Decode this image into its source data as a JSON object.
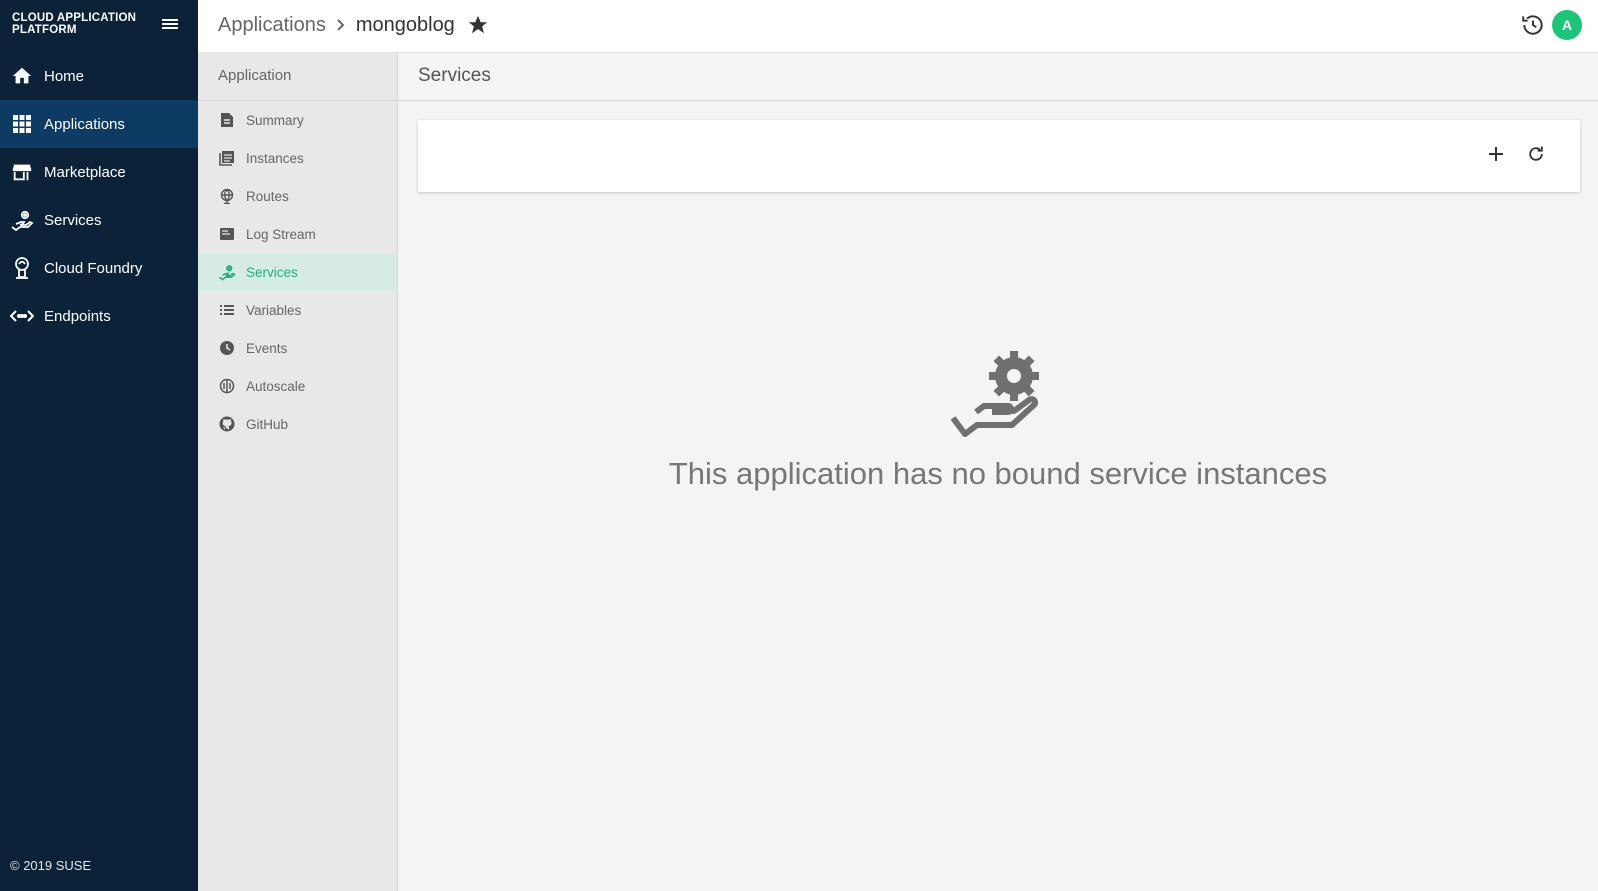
{
  "brand": {
    "line1": "CLOUD APPLICATION",
    "line2": "PLATFORM"
  },
  "sidebar": {
    "items": [
      {
        "label": "Home",
        "icon": "home-icon"
      },
      {
        "label": "Applications",
        "icon": "apps-grid-icon",
        "active": true
      },
      {
        "label": "Marketplace",
        "icon": "store-icon"
      },
      {
        "label": "Services",
        "icon": "service-hand-icon"
      },
      {
        "label": "Cloud Foundry",
        "icon": "cloud-foundry-icon"
      },
      {
        "label": "Endpoints",
        "icon": "endpoints-icon"
      }
    ],
    "copyright": "© 2019 SUSE"
  },
  "header": {
    "breadcrumb_parent": "Applications",
    "breadcrumb_current": "mongoblog",
    "avatar_initial": "A"
  },
  "subnav": {
    "title": "Application",
    "items": [
      {
        "label": "Summary",
        "icon": "document-icon"
      },
      {
        "label": "Instances",
        "icon": "instances-icon"
      },
      {
        "label": "Routes",
        "icon": "globe-icon"
      },
      {
        "label": "Log Stream",
        "icon": "log-icon"
      },
      {
        "label": "Services",
        "icon": "service-hand-icon",
        "active": true
      },
      {
        "label": "Variables",
        "icon": "list-icon"
      },
      {
        "label": "Events",
        "icon": "clock-icon"
      },
      {
        "label": "Autoscale",
        "icon": "autoscale-icon"
      },
      {
        "label": "GitHub",
        "icon": "github-icon"
      }
    ]
  },
  "main": {
    "title": "Services",
    "empty_message": "This application has no bound service instances"
  },
  "colors": {
    "sidebar_bg": "#0c2238",
    "sidebar_active": "#0d3b63",
    "accent_green": "#1fc47b",
    "subnav_active_bg": "#d6ebe3"
  }
}
